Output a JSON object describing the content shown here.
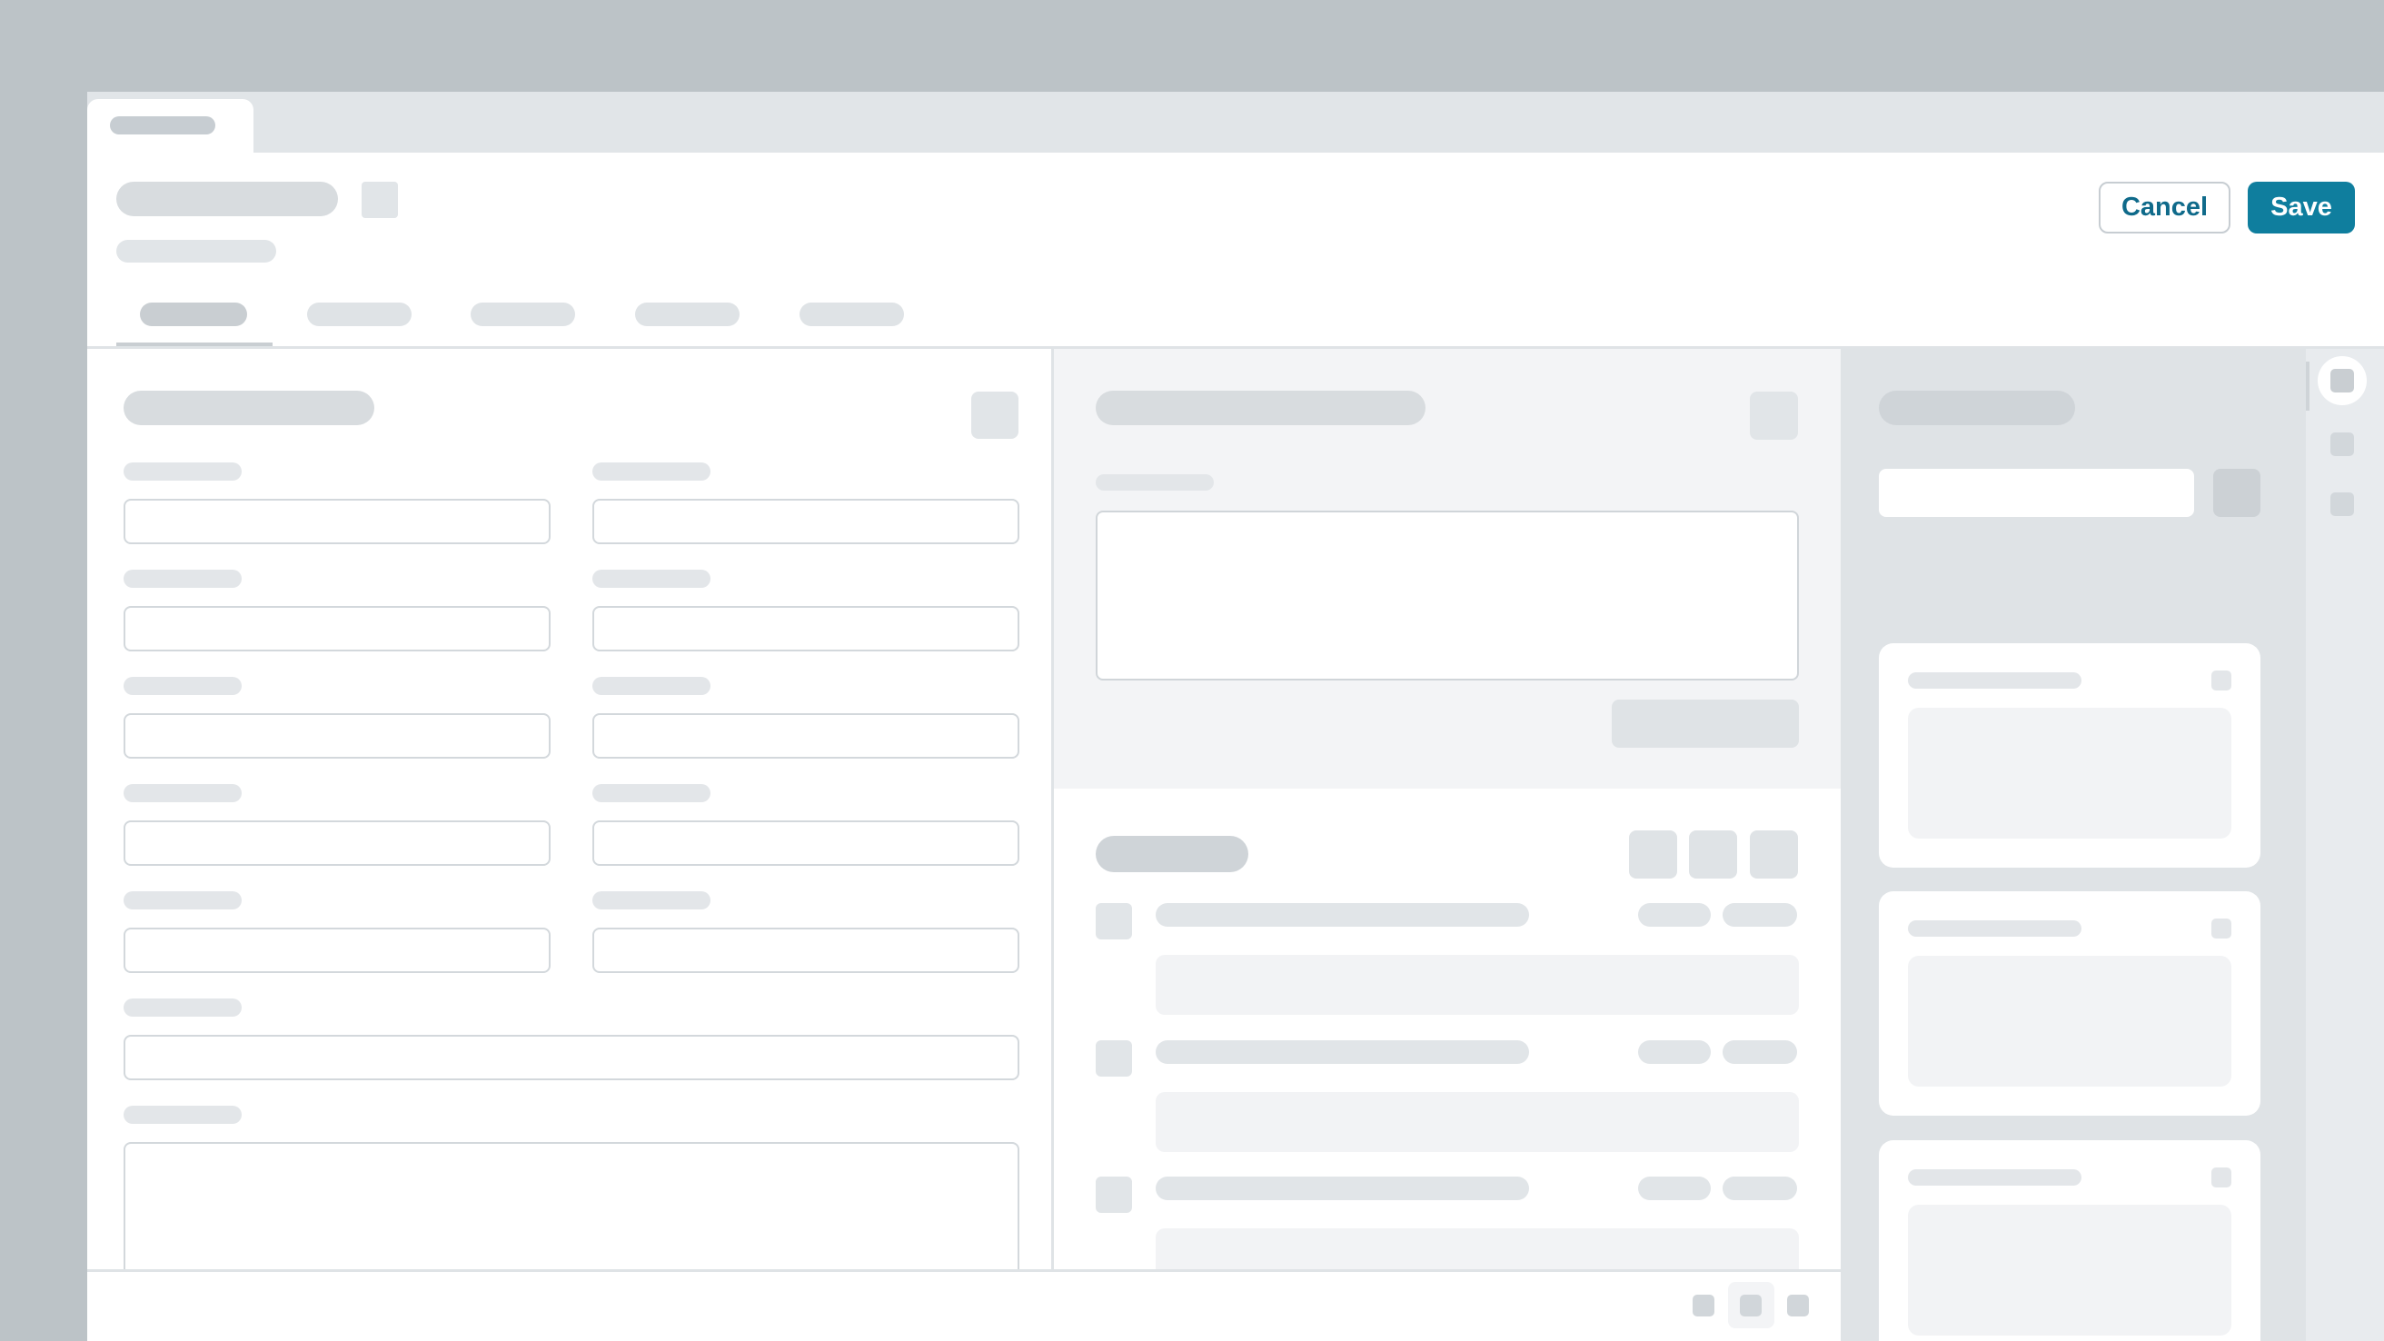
{
  "header": {
    "cancel_label": "Cancel",
    "save_label": "Save"
  },
  "colors": {
    "accent": "#0f7e9e",
    "accent_text": "#0f6a8a",
    "background": "#bcc3c7",
    "placeholder_gray": "#dfe3e6"
  },
  "icons": {
    "title_action": "square-icon",
    "rail": [
      "selected-circle-icon",
      "square-icon",
      "square-icon"
    ],
    "footer": [
      "square-icon",
      "square-icon",
      "square-icon"
    ]
  }
}
